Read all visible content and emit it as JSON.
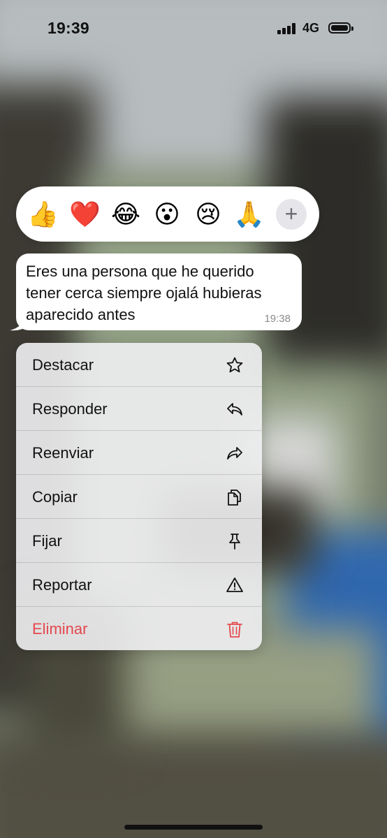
{
  "status_bar": {
    "time": "19:39",
    "network": "4G"
  },
  "reactions": {
    "items": [
      {
        "name": "thumbs-up",
        "glyph": "👍"
      },
      {
        "name": "red-heart",
        "glyph": "❤️"
      },
      {
        "name": "tears-of-joy",
        "glyph": "😂"
      },
      {
        "name": "surprised",
        "glyph": "😮"
      },
      {
        "name": "crying",
        "glyph": "😢"
      },
      {
        "name": "folded-hands",
        "glyph": "🙏"
      }
    ],
    "more_glyph": "+"
  },
  "message": {
    "text": "Eres una persona que he querido tener cerca siempre ojalá hubieras aparecido antes",
    "time": "19:38"
  },
  "menu": {
    "items": [
      {
        "label": "Destacar",
        "icon": "star-icon"
      },
      {
        "label": "Responder",
        "icon": "reply-icon"
      },
      {
        "label": "Reenviar",
        "icon": "forward-icon"
      },
      {
        "label": "Copiar",
        "icon": "copy-icon"
      },
      {
        "label": "Fijar",
        "icon": "pin-icon"
      },
      {
        "label": "Reportar",
        "icon": "warning-icon"
      },
      {
        "label": "Eliminar",
        "icon": "trash-icon",
        "destructive": true
      }
    ],
    "danger_color": "#e5484d"
  }
}
